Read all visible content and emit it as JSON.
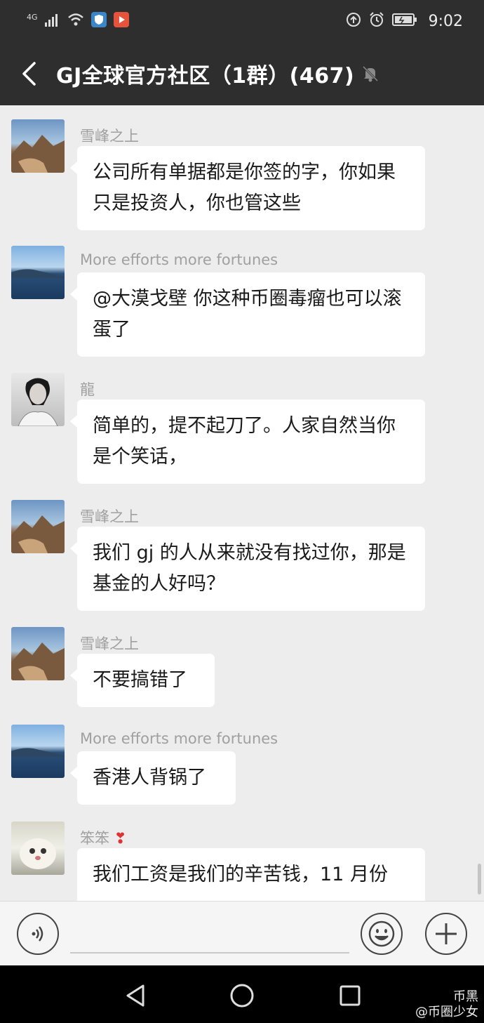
{
  "status_bar": {
    "network": "4G",
    "time": "9:02"
  },
  "header": {
    "title": "GJ全球官方社区（1群）(467)"
  },
  "messages": [
    {
      "sender": "雪峰之上",
      "avatar": "mountain-avatar",
      "text": "公司所有单据都是你签的字，你如果只是投资人，你也管这些"
    },
    {
      "sender": "More efforts  more fortunes",
      "avatar": "lake-avatar",
      "text": "@大漠戈壁  你这种币圈毒瘤也可以滚蛋了"
    },
    {
      "sender": "龍",
      "avatar": "man-portrait-avatar",
      "text": "简单的，提不起刀了。人家自然当你是个笑话，"
    },
    {
      "sender": "雪峰之上",
      "avatar": "mountain-avatar",
      "text": "我们 gj 的人从来就没有找过你，那是基金的人好吗？"
    },
    {
      "sender": "雪峰之上",
      "avatar": "mountain-avatar",
      "text": "不要搞错了"
    },
    {
      "sender": "More efforts  more fortunes",
      "avatar": "lake-avatar",
      "text": "香港人背锅了"
    },
    {
      "sender": "笨笨",
      "avatar": "cat-avatar",
      "text": "我们工资是我们的辛苦钱，11 月份"
    }
  ],
  "watermark": {
    "line1": "币黑",
    "line2": "@币圈少女"
  },
  "colors": {
    "header_bg": "#2e2e2e",
    "chat_bg": "#ededed",
    "bubble_bg": "#ffffff",
    "nav_bg": "#000000"
  }
}
